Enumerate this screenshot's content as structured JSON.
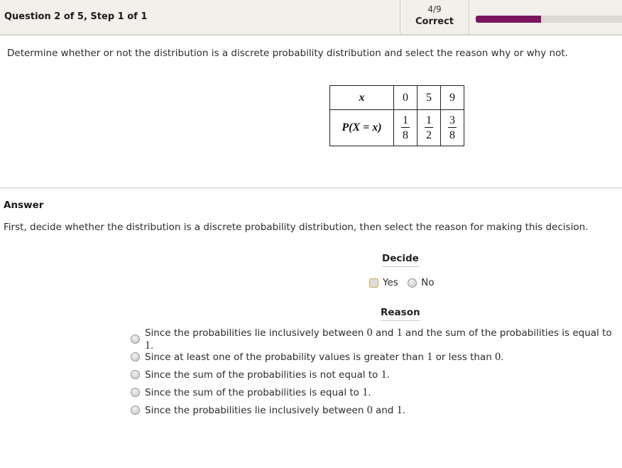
{
  "header": {
    "question_title": "Question 2 of 5, Step 1 of 1",
    "score_fraction": "4/9",
    "score_label": "Correct",
    "progress": {
      "correct": 4,
      "total": 9,
      "fraction": 0.444,
      "fill_color": "#7a1660",
      "track_color": "#dcd9d5"
    }
  },
  "question": {
    "prompt": "Determine whether or not the distribution is a discrete probability distribution and select the reason why or why not.",
    "table": {
      "row_headers": [
        "x",
        "P(X = x)"
      ],
      "x_values": [
        "0",
        "5",
        "9"
      ],
      "probabilities": [
        {
          "num": "1",
          "den": "8"
        },
        {
          "num": "1",
          "den": "2"
        },
        {
          "num": "3",
          "den": "8"
        }
      ]
    }
  },
  "answer": {
    "label": "Answer",
    "instruction": "First, decide whether the distribution is a discrete probability distribution, then select the reason for making this decision.",
    "decide": {
      "label": "Decide",
      "options": [
        {
          "label": "Yes",
          "focused": true,
          "selected": false
        },
        {
          "label": "No",
          "focused": false,
          "selected": false
        }
      ]
    },
    "reason": {
      "label": "Reason",
      "options": [
        {
          "parts": [
            "Since the probabilities lie inclusively between ",
            "0",
            " and ",
            "1",
            " and the sum of the probabilities is equal to ",
            "1",
            "."
          ]
        },
        {
          "parts": [
            "Since at least one of the probability values is greater than ",
            "1",
            " or less than ",
            "0",
            "."
          ]
        },
        {
          "parts": [
            "Since the sum of the probabilities is not equal to ",
            "1",
            "."
          ]
        },
        {
          "parts": [
            "Since the sum of the probabilities is equal to ",
            "1",
            "."
          ]
        },
        {
          "parts": [
            "Since the probabilities lie inclusively between ",
            "0",
            " and ",
            "1",
            "."
          ]
        }
      ]
    }
  }
}
